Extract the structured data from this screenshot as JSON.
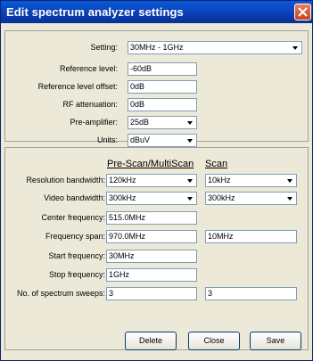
{
  "window": {
    "title": "Edit spectrum analyzer settings"
  },
  "top": {
    "setting": {
      "label": "Setting:",
      "value": "30MHz - 1GHz"
    },
    "reference_level": {
      "label": "Reference level:",
      "value": "-60dB"
    },
    "reference_level_offset": {
      "label": "Reference level offset:",
      "value": "0dB"
    },
    "rf_attenuation": {
      "label": "RF attenuation:",
      "value": "0dB"
    },
    "pre_amplifier": {
      "label": "Pre-amplifier:",
      "value": "25dB"
    },
    "units": {
      "label": "Units:",
      "value": "dBuV"
    }
  },
  "columns": {
    "prescan": "Pre-Scan/MultiScan",
    "scan": "Scan"
  },
  "rows": {
    "resolution_bandwidth": {
      "label": "Resolution bandwidth:",
      "prescan": "120kHz",
      "scan": "10kHz"
    },
    "video_bandwidth": {
      "label": "Video bandwidth:",
      "prescan": "300kHz",
      "scan": "300kHz"
    },
    "center_frequency": {
      "label": "Center frequency:",
      "prescan": "515.0MHz"
    },
    "frequency_span": {
      "label": "Frequency span:",
      "prescan": "970.0MHz",
      "scan": "10MHz"
    },
    "start_frequency": {
      "label": "Start frequency:",
      "prescan": "30MHz"
    },
    "stop_frequency": {
      "label": "Stop frequency:",
      "prescan": "1GHz"
    },
    "spectrum_sweeps": {
      "label": "No. of spectrum sweeps:",
      "prescan": "3",
      "scan": "3"
    }
  },
  "buttons": {
    "delete": "Delete",
    "close": "Close",
    "save": "Save"
  }
}
